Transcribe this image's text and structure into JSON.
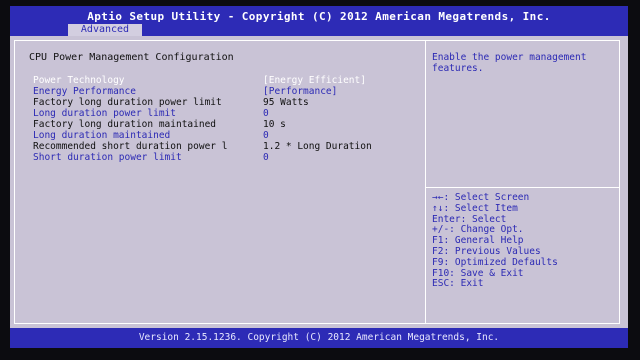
{
  "header": {
    "title": "Aptio Setup Utility - Copyright (C) 2012 American Megatrends, Inc.",
    "active_tab": "Advanced"
  },
  "main": {
    "section_title": "CPU Power Management Configuration",
    "rows": [
      {
        "label": "Power Technology",
        "value": "[Energy Efficient]"
      },
      {
        "label": "Energy Performance",
        "value": "[Performance]"
      },
      {
        "label": "Factory long duration power limit",
        "value": "95 Watts"
      },
      {
        "label": "Long duration power limit",
        "value": "0"
      },
      {
        "label": "Factory long duration maintained",
        "value": "10 s"
      },
      {
        "label": "Long duration maintained",
        "value": "0"
      },
      {
        "label": "Recommended short duration power l",
        "value": "1.2 * Long Duration"
      },
      {
        "label": "Short duration power limit",
        "value": "0"
      }
    ]
  },
  "help": {
    "description": "Enable the power management features."
  },
  "keys": [
    "→←: Select Screen",
    "↑↓: Select Item",
    "Enter: Select",
    "+/-: Change Opt.",
    "F1: General Help",
    "F2: Previous Values",
    "F9: Optimized Defaults",
    "F10: Save & Exit",
    "ESC: Exit"
  ],
  "footer": {
    "version": "Version 2.15.1236. Copyright (C) 2012 American Megatrends, Inc."
  },
  "colors": {
    "header_blue": "#2d2bb6",
    "panel_bg": "#c9c3d6",
    "selected_text": "#ffffff",
    "configurable_text": "#2c2ab4",
    "static_text": "#101010"
  }
}
